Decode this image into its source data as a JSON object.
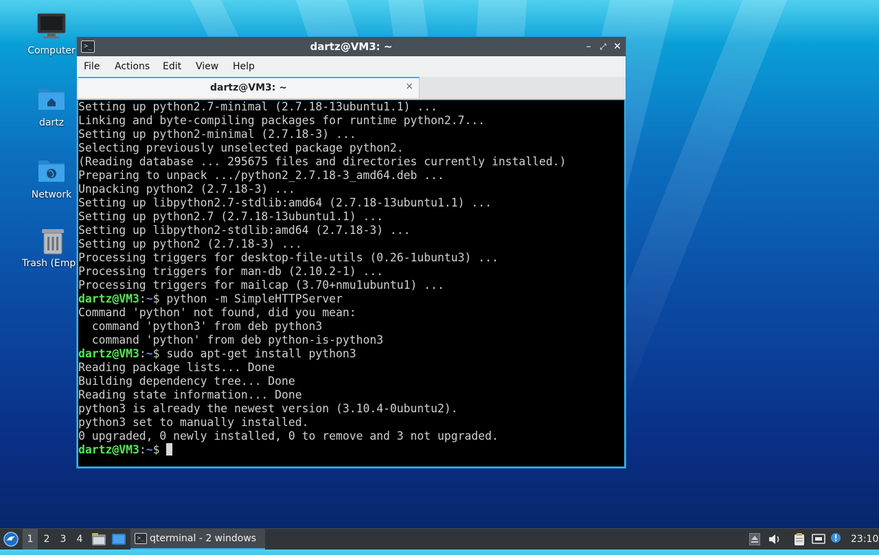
{
  "desktop": {
    "icons": [
      {
        "label": "Computer",
        "icon": "monitor-icon"
      },
      {
        "label": "dartz",
        "icon": "home-folder-icon"
      },
      {
        "label": "Network",
        "icon": "network-folder-icon"
      },
      {
        "label": "Trash (Empty)",
        "icon": "trash-icon"
      }
    ]
  },
  "window": {
    "title": "dartz@VM3: ~",
    "controls": [
      "minimize",
      "maximize",
      "close"
    ],
    "menu": [
      "File",
      "Actions",
      "Edit",
      "View",
      "Help"
    ],
    "tab": {
      "label": "dartz@VM3: ~",
      "close": "×"
    }
  },
  "terminal": {
    "prompt_user": "dartz@VM3",
    "prompt_sep": ":",
    "prompt_path": "~",
    "prompt_end": "$ ",
    "lines": [
      {
        "text": "Setting up python2.7-minimal (2.7.18-13ubuntu1.1) ..."
      },
      {
        "text": "Linking and byte-compiling packages for runtime python2.7..."
      },
      {
        "text": "Setting up python2-minimal (2.7.18-3) ..."
      },
      {
        "text": "Selecting previously unselected package python2."
      },
      {
        "text": "(Reading database ... 295675 files and directories currently installed.)"
      },
      {
        "text": "Preparing to unpack .../python2_2.7.18-3_amd64.deb ..."
      },
      {
        "text": "Unpacking python2 (2.7.18-3) ..."
      },
      {
        "text": "Setting up libpython2.7-stdlib:amd64 (2.7.18-13ubuntu1.1) ..."
      },
      {
        "text": "Setting up python2.7 (2.7.18-13ubuntu1.1) ..."
      },
      {
        "text": "Setting up libpython2-stdlib:amd64 (2.7.18-3) ..."
      },
      {
        "text": "Setting up python2 (2.7.18-3) ..."
      },
      {
        "text": "Processing triggers for desktop-file-utils (0.26-1ubuntu3) ..."
      },
      {
        "text": "Processing triggers for man-db (2.10.2-1) ..."
      },
      {
        "text": "Processing triggers for mailcap (3.70+nmu1ubuntu1) ..."
      },
      {
        "prompt": true,
        "text": "python -m SimpleHTTPServer"
      },
      {
        "text": "Command 'python' not found, did you mean:"
      },
      {
        "text": "  command 'python3' from deb python3"
      },
      {
        "text": "  command 'python' from deb python-is-python3"
      },
      {
        "prompt": true,
        "text": "sudo apt-get install python3"
      },
      {
        "text": "Reading package lists... Done"
      },
      {
        "text": "Building dependency tree... Done"
      },
      {
        "text": "Reading state information... Done"
      },
      {
        "text": "python3 is already the newest version (3.10.4-0ubuntu2)."
      },
      {
        "text": "python3 set to manually installed."
      },
      {
        "text": "0 upgraded, 0 newly installed, 0 to remove and 3 not upgraded."
      },
      {
        "prompt": true,
        "text": "",
        "cursor": true
      }
    ]
  },
  "taskbar": {
    "workspaces": [
      "1",
      "2",
      "3",
      "4"
    ],
    "active_workspace": "1",
    "task_label": "qterminal - 2 windows",
    "clock": "23:10",
    "accent": "#3daee9"
  }
}
